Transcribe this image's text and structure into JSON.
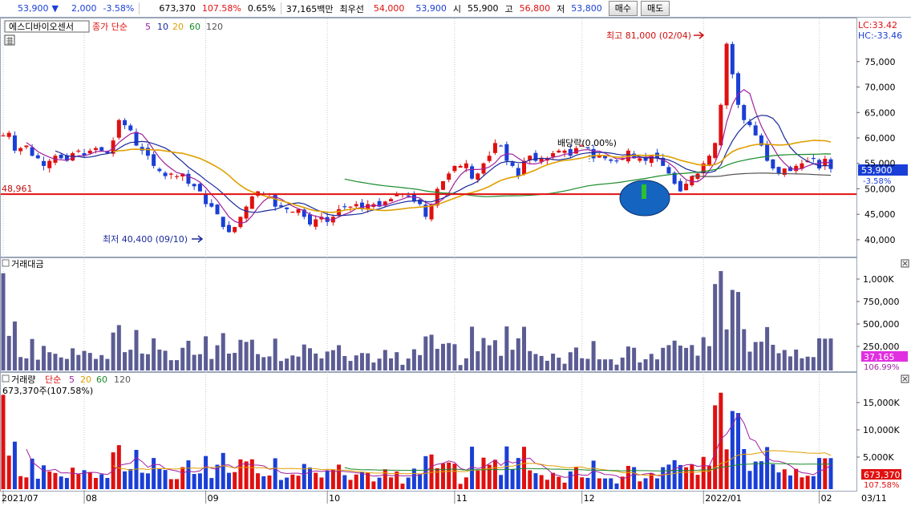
{
  "quote": {
    "price": "53,900",
    "arrow": "▼",
    "change": "2,000",
    "change_pct": "-3.58%",
    "volume": "673,370",
    "volume_ratio": "107.58%",
    "turnover": "0.65%",
    "amount": "37,165백만",
    "best_ask_label": "최우선",
    "best_ask": "54,000",
    "best_bid": "53,900",
    "open_label": "시",
    "open": "55,900",
    "high_label": "고",
    "high": "56,800",
    "low_label": "저",
    "low": "53,800",
    "buy_button": "매수",
    "sell_button": "매도"
  },
  "colors": {
    "up": "#e01010",
    "down": "#1a3fd6",
    "ma5": "#a020a0",
    "ma10": "#1a2a9a",
    "ma20": "#e0a000",
    "ma60": "#1a8a2a",
    "ma120": "#555555",
    "highlight": "#1565c0"
  },
  "price_panel": {
    "stock_name": "에스디바이오센서",
    "legend": {
      "prefix": "종가 단순",
      "periods": [
        "5",
        "10",
        "20",
        "60",
        "120"
      ]
    },
    "lc": "LC:33.42",
    "hc": "HC:-33.46",
    "support_label": "48,961",
    "high_annotation": "최고 81,000 (02/04)",
    "low_annotation": "최저 40,400 (09/10)",
    "dividend_annotation": "배당락(0.00%)",
    "current_price": "53,900",
    "current_pct": "-3.58%",
    "y_ticks": [
      "75,000",
      "70,000",
      "65,000",
      "60,000",
      "55,000",
      "50,000",
      "45,000",
      "40,000"
    ]
  },
  "amount_panel": {
    "title": "거래대금",
    "y_ticks": [
      "1,000K",
      "750,000",
      "500,000",
      "250,000"
    ],
    "current": "37,165",
    "current_pct": "106.99%"
  },
  "volume_panel": {
    "title": "거래량",
    "legend": {
      "prefix": "단순",
      "periods": [
        "5",
        "20",
        "60",
        "120"
      ]
    },
    "subtitle": "673,370주(107.58%)",
    "y_ticks": [
      "15,000K",
      "10,000K",
      "5,000K"
    ],
    "current": "673,370",
    "current_pct": "107.58%"
  },
  "x_axis": {
    "labels": [
      "2021/07",
      "08",
      "09",
      "10",
      "11",
      "12",
      "2022/01",
      "02",
      "03",
      "03/11"
    ]
  },
  "chart_data": {
    "type": "candlestick",
    "ylim": [
      37000,
      83000
    ],
    "support_level": 48961,
    "closes": [
      60500,
      61000,
      57500,
      58000,
      58500,
      56500,
      56000,
      54500,
      55500,
      56500,
      56000,
      55500,
      57000,
      57500,
      56500,
      57500,
      58000,
      57500,
      57000,
      59500,
      63500,
      62500,
      61500,
      58500,
      57500,
      56500,
      54500,
      53500,
      52500,
      53000,
      52500,
      53000,
      51000,
      50500,
      49500,
      47000,
      46500,
      45000,
      42500,
      41500,
      42500,
      44500,
      46500,
      48500,
      49500,
      49000,
      48500,
      46500,
      46500,
      46000,
      45500,
      46000,
      44500,
      43000,
      44000,
      44500,
      43500,
      44500,
      46000,
      46500,
      46500,
      47000,
      46000,
      47000,
      47000,
      46500,
      47500,
      48000,
      49000,
      49000,
      48500,
      47500,
      47000,
      44500,
      47000,
      50000,
      51500,
      53000,
      54500,
      54500,
      55000,
      52000,
      53000,
      55000,
      56500,
      59000,
      58500,
      55500,
      54500,
      52500,
      55500,
      56500,
      55500,
      56000,
      56000,
      57000,
      57500,
      57500,
      56500,
      58000,
      58500,
      58000,
      56000,
      56500,
      56000,
      55500,
      55500,
      56000,
      57500,
      56000,
      56000,
      55500,
      56500,
      56000,
      54500,
      53000,
      51000,
      49500,
      51000,
      52500,
      53000,
      55000,
      56500,
      59000,
      66500,
      78500,
      72500,
      66500,
      63500,
      62500,
      60500,
      58500,
      55500,
      54000,
      53000,
      54000,
      53500,
      54500,
      55000,
      55500,
      56000,
      54000,
      55900,
      53900
    ],
    "series": [
      {
        "name": "종가 단순 5",
        "values": [],
        "note": "moving average lines drawn from closes"
      },
      {
        "name": "거래대금",
        "unit": "백만"
      },
      {
        "name": "거래량",
        "unit": "주"
      }
    ]
  }
}
